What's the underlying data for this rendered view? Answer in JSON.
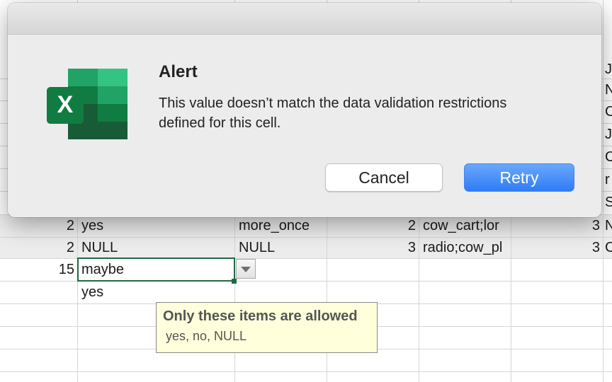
{
  "spreadsheet": {
    "rows": [
      {
        "a": "2",
        "b": "yes",
        "c": "more_once",
        "d": "2",
        "e": "cow_cart;lor",
        "f": "3",
        "g": "N"
      },
      {
        "a": "2",
        "b": "NULL",
        "c": "NULL",
        "d": "3",
        "e": "radio;cow_pl",
        "f": "3",
        "g": "C"
      },
      {
        "a": "15",
        "b": "maybe",
        "c": "",
        "d": "",
        "e": "",
        "f": "",
        "g": ""
      }
    ],
    "dropdown_option_yes": "yes",
    "edge_letters_behind_dialog": [
      "J",
      "N",
      "C",
      "J",
      "C",
      "r",
      "S"
    ],
    "validation_tooltip": {
      "title": "Only these items are allowed",
      "body": "yes, no, NULL"
    }
  },
  "alert": {
    "title": "Alert",
    "message": "This value doesn’t match the data validation restrictions defined for this cell.",
    "cancel_label": "Cancel",
    "retry_label": "Retry",
    "logo_letter": "X",
    "icon": "excel-app-icon"
  },
  "colors": {
    "excel_green_dark": "#185c37",
    "excel_green": "#21a366",
    "excel_green_light": "#33c481",
    "retry_blue": "#2f7cf5",
    "tooltip_bg": "#ffffdc",
    "active_cell_border": "#1e6b43"
  }
}
